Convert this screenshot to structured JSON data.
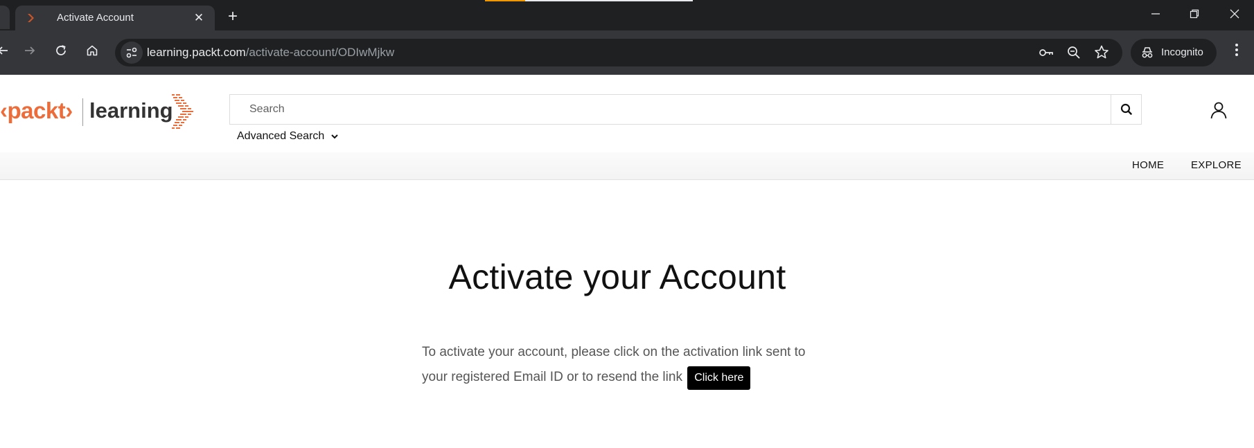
{
  "browser": {
    "tab_title": "Activate Account",
    "new_tab_symbol": "+",
    "close_tab_symbol": "✕",
    "url_host": "learning.packt.com",
    "url_path": "/activate-account/ODIwMjkw",
    "incognito_label": "Incognito",
    "window_controls": {
      "minimize": "—",
      "restore": "❐",
      "close": "✕"
    },
    "icons": [
      "back-icon",
      "forward-icon",
      "reload-icon",
      "home-icon",
      "site-info-icon",
      "password-key-icon",
      "zoom-out-icon",
      "bookmark-star-icon",
      "incognito-icon",
      "menu-icon"
    ]
  },
  "header": {
    "logo_brand": "‹packt›",
    "logo_product": "learning",
    "search_placeholder": "Search",
    "advanced_search_label": "Advanced Search"
  },
  "nav": {
    "home_label": "HOME",
    "explore_label": "EXPLORE"
  },
  "main": {
    "title": "Activate your Account",
    "message_line1": "To activate your account, please click on the activation link sent to",
    "message_line2": "your registered Email ID or to resend the link",
    "click_here_label": "Click here"
  },
  "colors": {
    "brand_orange": "#ec6c3a",
    "chrome_dark": "#1f2021",
    "chrome_toolbar": "#35363a"
  }
}
